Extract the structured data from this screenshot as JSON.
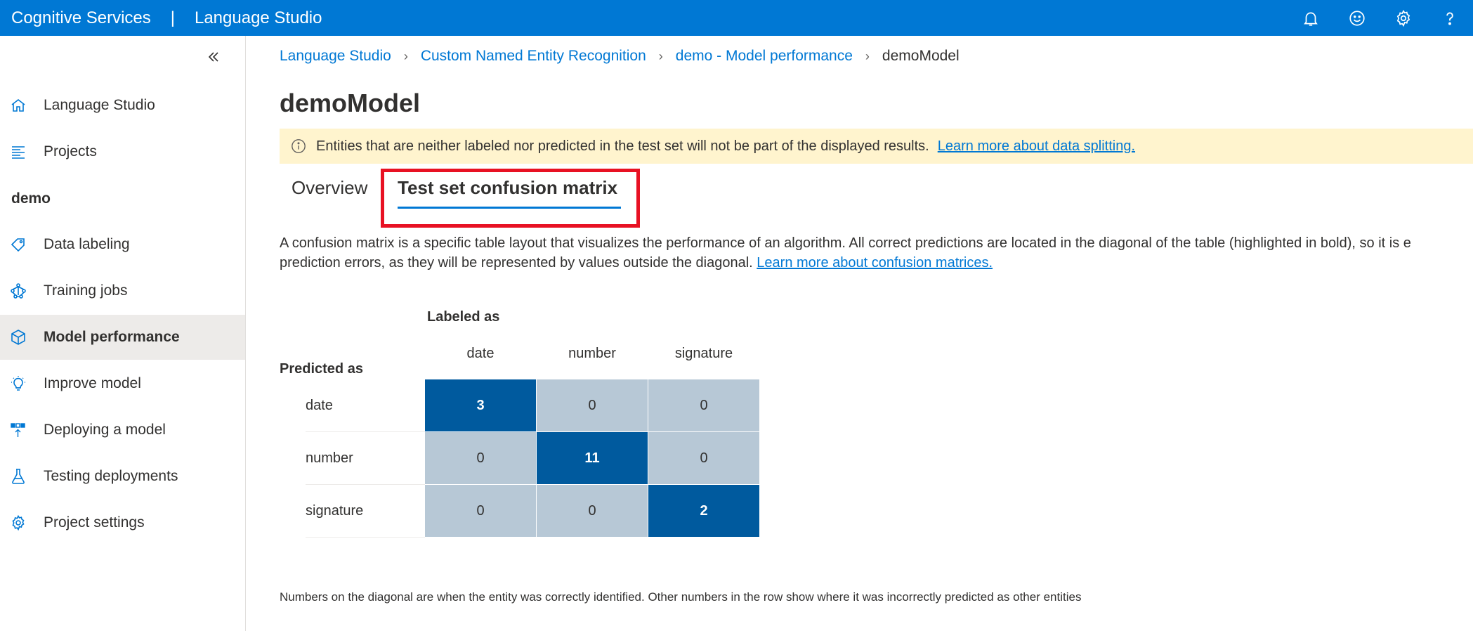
{
  "topbar": {
    "brand": "Cognitive Services",
    "separator": "|",
    "product": "Language Studio",
    "actions": [
      "bell-icon",
      "smiley-icon",
      "gear-icon",
      "help-icon"
    ]
  },
  "sidebar": {
    "top_items": [
      {
        "label": "Language Studio",
        "icon": "home-icon"
      },
      {
        "label": "Projects",
        "icon": "list-icon"
      }
    ],
    "section": "demo",
    "items": [
      {
        "label": "Data labeling",
        "icon": "tag-icon"
      },
      {
        "label": "Training jobs",
        "icon": "network-icon"
      },
      {
        "label": "Model performance",
        "icon": "cube-icon",
        "active": true
      },
      {
        "label": "Improve model",
        "icon": "lightbulb-icon"
      },
      {
        "label": "Deploying a model",
        "icon": "deploy-icon"
      },
      {
        "label": "Testing deployments",
        "icon": "flask-icon"
      },
      {
        "label": "Project settings",
        "icon": "gear-icon"
      }
    ]
  },
  "breadcrumb": {
    "items": [
      "Language Studio",
      "Custom Named Entity Recognition",
      "demo - Model performance"
    ],
    "current": "demoModel"
  },
  "page": {
    "title": "demoModel",
    "banner_text": "Entities that are neither labeled nor predicted in the test set will not be part of the displayed results.",
    "banner_link": "Learn more about data splitting.",
    "tabs": [
      "Overview",
      "Test set confusion matrix"
    ],
    "description_line1": "A confusion matrix is a specific table layout that visualizes the performance of an algorithm. All correct predictions are located in the diagonal of the table (highlighted in bold), so it is e",
    "description_line2": "prediction errors, as they will be represented by values outside the diagonal.",
    "description_link": "Learn more about confusion matrices.",
    "footnote": "Numbers on the diagonal are when the entity was correctly identified. Other numbers in the row show where it was incorrectly predicted as other entities"
  },
  "matrix": {
    "labeled_as": "Labeled as",
    "predicted_as": "Predicted as",
    "columns": [
      "date",
      "number",
      "signature"
    ],
    "rows": [
      {
        "label": "date",
        "values": [
          "3",
          "0",
          "0"
        ]
      },
      {
        "label": "number",
        "values": [
          "0",
          "11",
          "0"
        ]
      },
      {
        "label": "signature",
        "values": [
          "0",
          "0",
          "2"
        ]
      }
    ]
  },
  "colors": {
    "brand": "#0078d4",
    "diagonal": "#005a9e",
    "off_diagonal": "#b7c8d6",
    "highlight": "#e81123",
    "banner": "#fff4ce"
  }
}
